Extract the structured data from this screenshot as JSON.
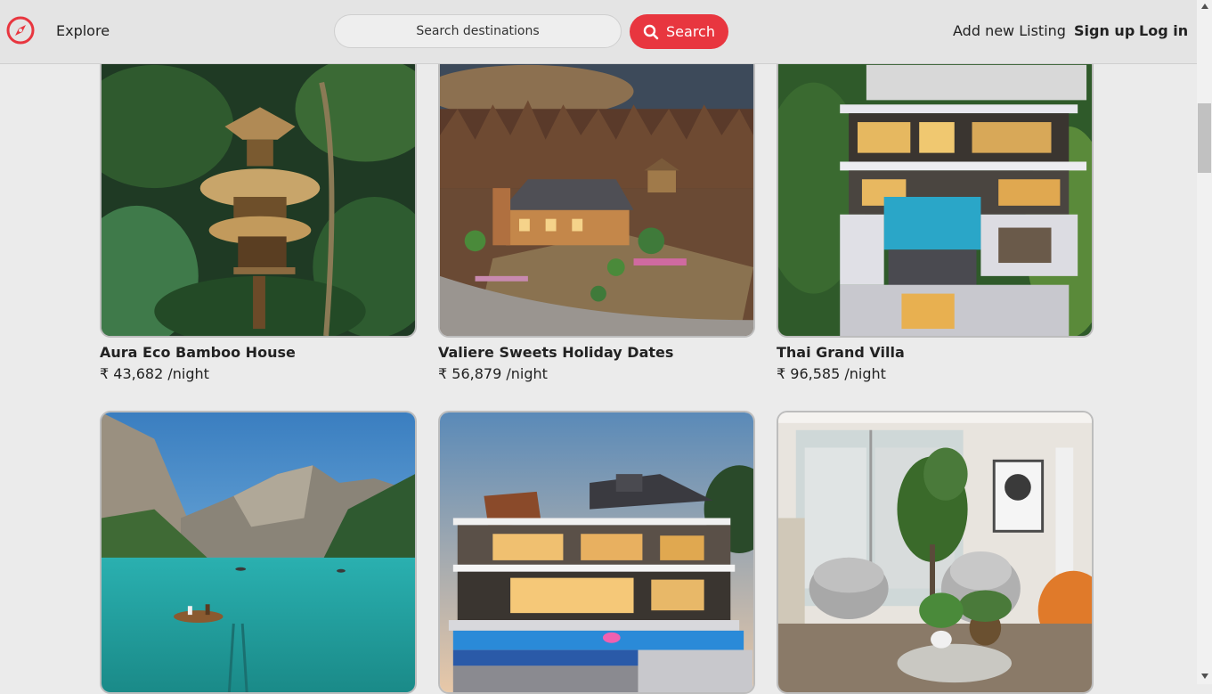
{
  "nav": {
    "explore_label": "Explore",
    "search_placeholder": "Search destinations",
    "search_button_label": "Search",
    "add_listing_label": "Add new Listing",
    "signup_label": "Sign up",
    "login_label": "Log in",
    "logo_icon": "compass-icon",
    "search_icon": "search-icon",
    "brand_color": "#e8363f"
  },
  "listings": [
    {
      "title": "Aura Eco Bamboo House",
      "price": "₹ 43,682 /night"
    },
    {
      "title": "Valiere Sweets Holiday Dates",
      "price": "₹ 56,879 /night"
    },
    {
      "title": "Thai Grand Villa",
      "price": "₹ 96,585 /night"
    },
    {
      "title": "",
      "price": ""
    },
    {
      "title": "",
      "price": ""
    },
    {
      "title": "",
      "price": ""
    }
  ]
}
